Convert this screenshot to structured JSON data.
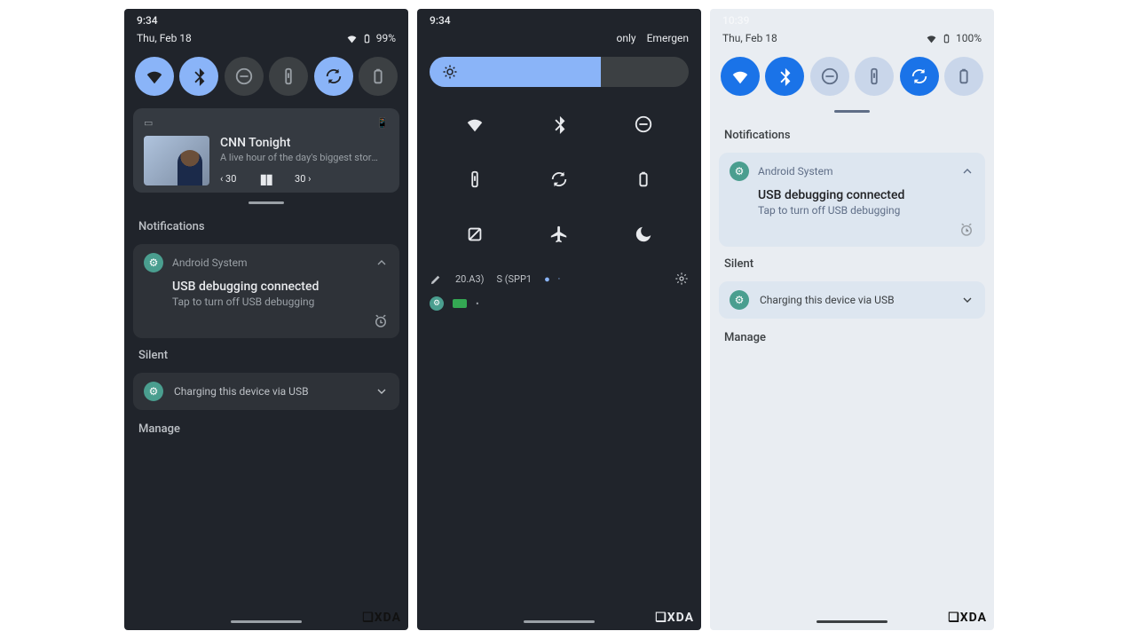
{
  "watermark": "❏XDA",
  "panel1": {
    "time": "9:34",
    "date": "Thu, Feb 18",
    "battery": "99%",
    "media": {
      "source_icon": "▭",
      "output_icon": "📱",
      "title": "CNN Tonight",
      "subtitle": "A live hour of the day's biggest stori…",
      "back": "‹ 30",
      "pause": "▮▮",
      "fwd": "30 ›"
    },
    "notifications_label": "Notifications",
    "system_notif": {
      "app": "Android System",
      "title": "USB debugging connected",
      "subtitle": "Tap to turn off USB debugging"
    },
    "silent_label": "Silent",
    "silent_item": "Charging this device via USB",
    "manage": "Manage"
  },
  "panel2": {
    "time": "9:34",
    "right1": "only",
    "right2": "Emergen",
    "brightness_pct": 66,
    "build1": "20.A3)",
    "build2": "S (SPP1"
  },
  "panel3": {
    "time": "10:39",
    "date": "Thu, Feb 18",
    "battery": "100%",
    "notifications_label": "Notifications",
    "system_notif": {
      "app": "Android System",
      "title": "USB debugging connected",
      "subtitle": "Tap to turn off USB debugging"
    },
    "silent_label": "Silent",
    "silent_item": "Charging this device via USB",
    "manage": "Manage"
  }
}
